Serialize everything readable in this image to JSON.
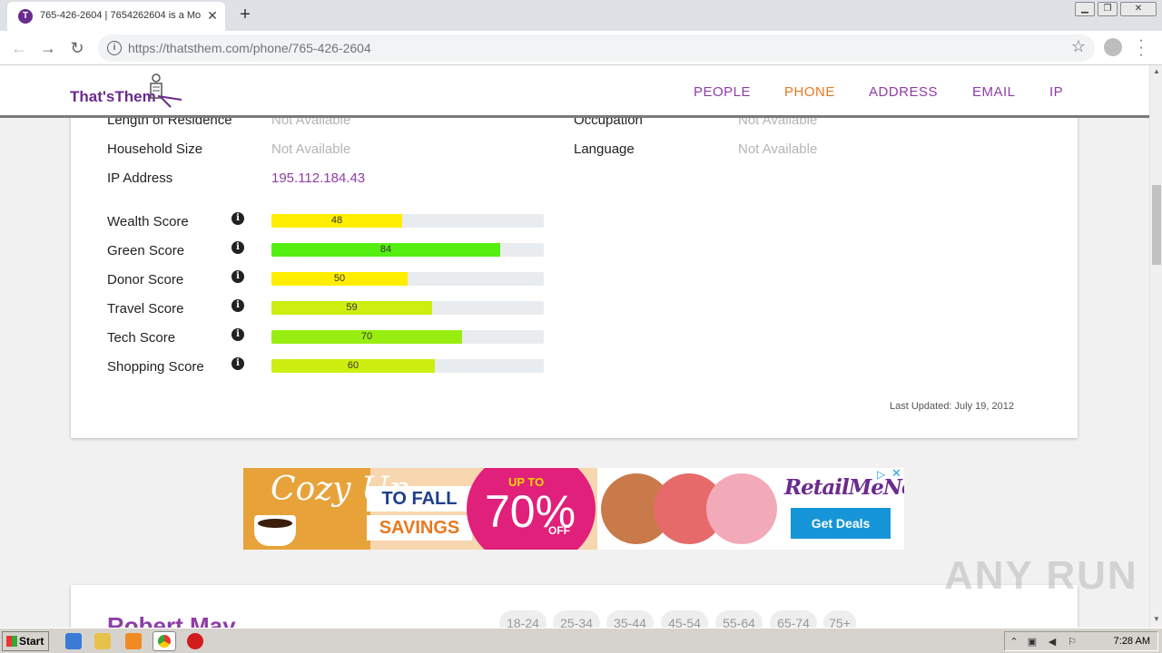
{
  "browser": {
    "tab_title": "765-426-2604 | 7654262604 is a Mo",
    "tab_favicon": "T",
    "url_host": "https://thatsthem.com",
    "url_path": "/phone/765-426-2604"
  },
  "site": {
    "logo_text": "That'sThem",
    "nav": [
      {
        "label": "PEOPLE",
        "active": false
      },
      {
        "label": "PHONE",
        "active": true
      },
      {
        "label": "ADDRESS",
        "active": false
      },
      {
        "label": "EMAIL",
        "active": false
      },
      {
        "label": "IP",
        "active": false
      }
    ]
  },
  "details": {
    "rows_left": [
      {
        "label": "Length of Residence",
        "value": "Not Available"
      },
      {
        "label": "Household Size",
        "value": "Not Available"
      },
      {
        "label": "IP Address",
        "value": "195.112.184.43"
      }
    ],
    "rows_right": [
      {
        "label": "Occupation",
        "value": "Not Available"
      },
      {
        "label": "Language",
        "value": "Not Available"
      }
    ]
  },
  "scores": [
    {
      "label": "Wealth Score",
      "value": "48",
      "percent": 48,
      "color": "#ffee00"
    },
    {
      "label": "Green Score",
      "value": "84",
      "percent": 84,
      "color": "#55ee11"
    },
    {
      "label": "Donor Score",
      "value": "50",
      "percent": 50,
      "color": "#ffee00"
    },
    {
      "label": "Travel Score",
      "value": "59",
      "percent": 59,
      "color": "#ccee11"
    },
    {
      "label": "Tech Score",
      "value": "70",
      "percent": 70,
      "color": "#99ee11"
    },
    {
      "label": "Shopping Score",
      "value": "60",
      "percent": 60,
      "color": "#ccee11"
    }
  ],
  "last_updated": "Last Updated: July 19, 2012",
  "ad": {
    "cozy": "Cozy Up",
    "to_fall": "TO FALL",
    "savings": "SAVINGS",
    "up_to": "UP TO",
    "percent": "70%",
    "off": "OFF",
    "brand": "RetailMeNot",
    "cta": "Get Deals"
  },
  "next_person": {
    "name": "Robert May",
    "age_ranges": [
      "18-24",
      "25-34",
      "35-44",
      "45-54",
      "55-64",
      "65-74",
      "75+"
    ]
  },
  "watermark": "ANY RUN",
  "taskbar": {
    "start_label": "Start",
    "clock": "7:28 AM"
  }
}
